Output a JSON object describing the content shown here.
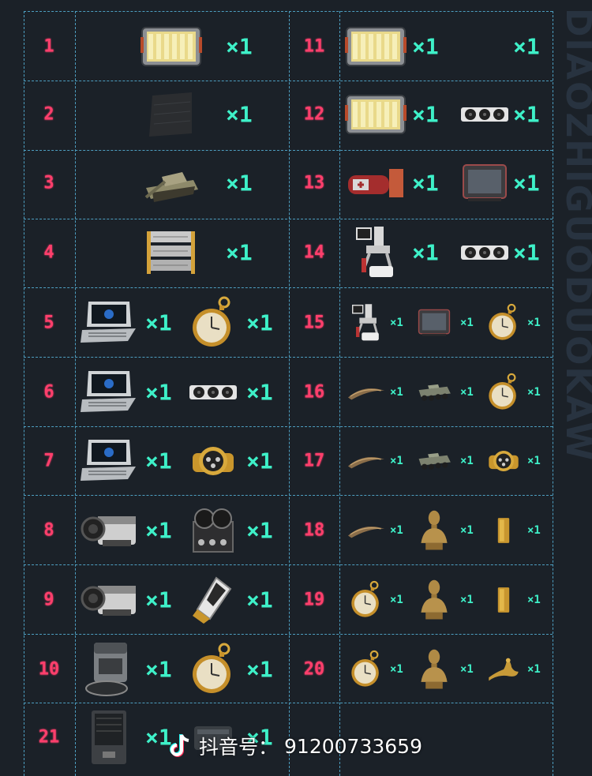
{
  "rows": [
    {
      "num": "1",
      "left_items": [
        {
          "icon": "battery-crate-icon",
          "qty": "×1"
        }
      ],
      "right_num": "11",
      "right_items": [
        {
          "icon": "battery-crate-icon",
          "qty": "×1"
        },
        {
          "icon": "",
          "qty": "×1"
        }
      ]
    },
    {
      "num": "2",
      "left_items": [
        {
          "icon": "carbon-plate-icon",
          "qty": "×1"
        }
      ],
      "right_num": "12",
      "right_items": [
        {
          "icon": "battery-crate-icon",
          "qty": "×1"
        },
        {
          "icon": "graphics-card-icon",
          "qty": "×1"
        }
      ]
    },
    {
      "num": "3",
      "left_items": [
        {
          "icon": "tank-icon",
          "qty": "×1"
        }
      ],
      "right_num": "13",
      "right_items": [
        {
          "icon": "medical-kit-icon",
          "qty": "×1"
        },
        {
          "icon": "tablet-monitor-icon",
          "qty": "×1"
        }
      ]
    },
    {
      "num": "4",
      "left_items": [
        {
          "icon": "server-rack-icon",
          "qty": "×1"
        }
      ],
      "right_num": "14",
      "right_items": [
        {
          "icon": "robot-arm-icon",
          "qty": "×1"
        },
        {
          "icon": "graphics-card-icon",
          "qty": "×1"
        }
      ]
    },
    {
      "num": "5",
      "left_items": [
        {
          "icon": "laptop-icon",
          "qty": "×1"
        },
        {
          "icon": "pocket-watch-icon",
          "qty": "×1"
        }
      ],
      "right_num": "15",
      "right_items": [
        {
          "icon": "robot-arm-icon",
          "qty": "×1"
        },
        {
          "icon": "tablet-monitor-icon",
          "qty": "×1"
        },
        {
          "icon": "pocket-watch-icon",
          "qty": "×1"
        }
      ]
    },
    {
      "num": "6",
      "left_items": [
        {
          "icon": "laptop-icon",
          "qty": "×1"
        },
        {
          "icon": "graphics-card-icon",
          "qty": "×1"
        }
      ],
      "right_num": "16",
      "right_items": [
        {
          "icon": "horn-icon",
          "qty": "×1"
        },
        {
          "icon": "armored-vehicle-icon",
          "qty": "×1"
        },
        {
          "icon": "pocket-watch-icon",
          "qty": "×1"
        }
      ]
    },
    {
      "num": "7",
      "left_items": [
        {
          "icon": "laptop-icon",
          "qty": "×1"
        },
        {
          "icon": "gold-watch-icon",
          "qty": "×1"
        }
      ],
      "right_num": "17",
      "right_items": [
        {
          "icon": "horn-icon",
          "qty": "×1"
        },
        {
          "icon": "armored-vehicle-icon",
          "qty": "×1"
        },
        {
          "icon": "gold-watch-icon",
          "qty": "×1"
        }
      ]
    },
    {
      "num": "8",
      "left_items": [
        {
          "icon": "camera-projector-icon",
          "qty": "×1"
        },
        {
          "icon": "reel-recorder-icon",
          "qty": "×1"
        }
      ],
      "right_num": "18",
      "right_items": [
        {
          "icon": "horn-icon",
          "qty": "×1"
        },
        {
          "icon": "bust-statue-icon",
          "qty": "×1"
        },
        {
          "icon": "gold-bar-icon",
          "qty": "×1"
        }
      ]
    },
    {
      "num": "9",
      "left_items": [
        {
          "icon": "camera-projector-icon",
          "qty": "×1"
        },
        {
          "icon": "usb-drive-icon",
          "qty": "×1"
        }
      ],
      "right_num": "19",
      "right_items": [
        {
          "icon": "pocket-watch-icon",
          "qty": "×1"
        },
        {
          "icon": "bust-statue-icon",
          "qty": "×1"
        },
        {
          "icon": "gold-bar-icon",
          "qty": "×1"
        }
      ]
    },
    {
      "num": "10",
      "left_items": [
        {
          "icon": "robot-vacuum-station-icon",
          "qty": "×1"
        },
        {
          "icon": "pocket-watch-icon",
          "qty": "×1"
        }
      ],
      "right_num": "20",
      "right_items": [
        {
          "icon": "pocket-watch-icon",
          "qty": "×1"
        },
        {
          "icon": "bust-statue-icon",
          "qty": "×1"
        },
        {
          "icon": "golden-hand-icon",
          "qty": "×1"
        }
      ]
    },
    {
      "num": "21",
      "left_items": [
        {
          "icon": "pc-tower-icon",
          "qty": "×1"
        },
        {
          "icon": "dark-case-icon",
          "qty": "×1"
        }
      ],
      "right_num": "",
      "right_items": []
    }
  ],
  "side_text": "DIAOZHIGUODUOKAW",
  "watermark": {
    "label": "抖音号：",
    "id": "91200733659"
  },
  "colors": {
    "background": "#1b2128",
    "grid": "#4d9ec0",
    "number": "#ff3f6c",
    "quantity": "#3ef0c8"
  }
}
